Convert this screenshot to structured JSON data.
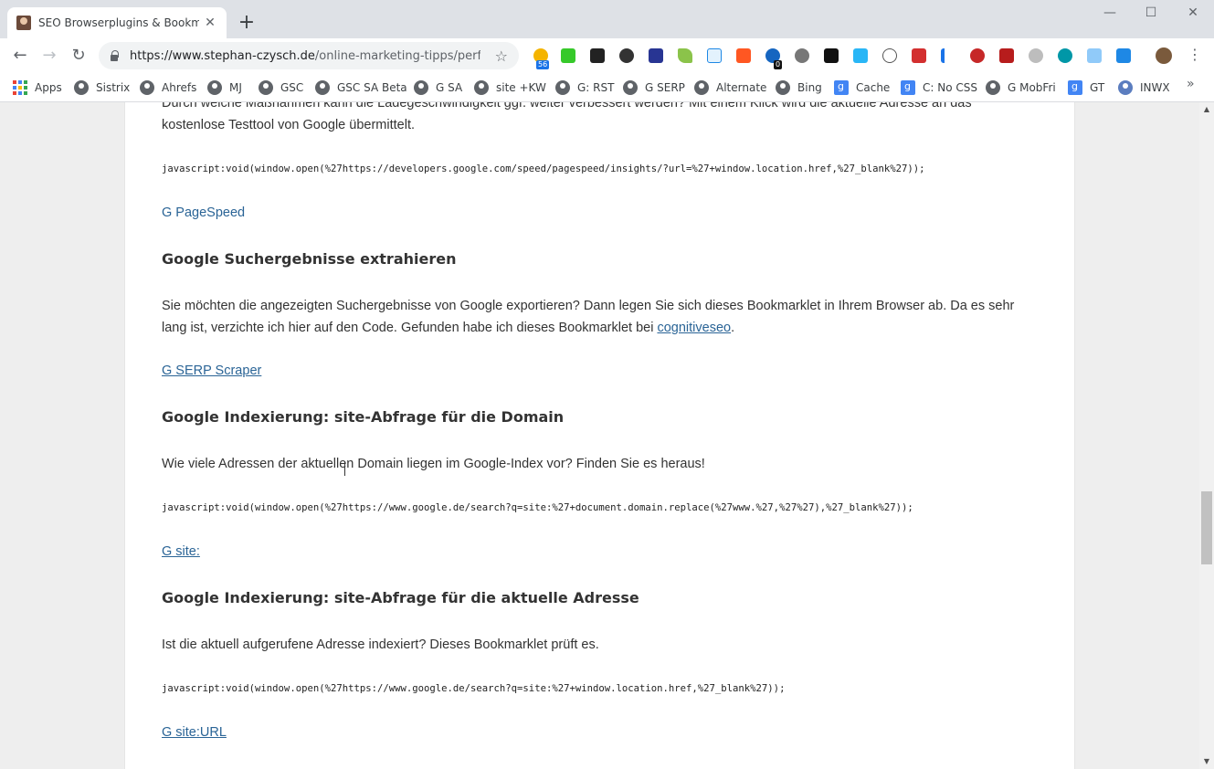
{
  "browser": {
    "tab_title": "SEO Browserplugins & Bookmarklets",
    "tab_close": "✕",
    "new_tab": "+",
    "window": {
      "minimize": "—",
      "maximize": "☐",
      "close": "✕"
    },
    "nav": {
      "back": "←",
      "forward": "→",
      "reload": "↻"
    },
    "url_host": "https://www.stephan-czysch.de",
    "url_path": "/online-marketing-tipps/perf...",
    "star": "☆",
    "ext_badges": {
      "first": "56",
      "second": "0"
    },
    "menu": "⋮",
    "bookmarks": [
      {
        "label": "Apps",
        "icon": "apps-grid-icon"
      },
      {
        "label": "Sistrix",
        "icon": "globe-icon"
      },
      {
        "label": "Ahrefs",
        "icon": "globe-icon"
      },
      {
        "label": "MJ",
        "icon": "globe-icon"
      },
      {
        "label": "GSC",
        "icon": "globe-icon"
      },
      {
        "label": "GSC SA Beta",
        "icon": "globe-icon"
      },
      {
        "label": "G SA",
        "icon": "globe-icon"
      },
      {
        "label": "site +KW",
        "icon": "globe-icon"
      },
      {
        "label": "G: RST",
        "icon": "globe-icon"
      },
      {
        "label": "G SERP",
        "icon": "globe-icon"
      },
      {
        "label": "Alternate",
        "icon": "globe-icon"
      },
      {
        "label": "Bing",
        "icon": "globe-icon"
      },
      {
        "label": "Cache",
        "icon": "google-icon"
      },
      {
        "label": "C: No CSS",
        "icon": "google-icon"
      },
      {
        "label": "G MobFri",
        "icon": "globe-icon"
      },
      {
        "label": "GT",
        "icon": "google-icon"
      },
      {
        "label": "INWX",
        "icon": "world-icon"
      }
    ],
    "bookmarks_more": "»"
  },
  "article": {
    "intro_line1": "Durch welche Maßnahmen kann die Ladegeschwindigkeit ggf. weiter verbessert werden? Mit einem Klick wird die aktuelle Adresse an das",
    "intro_line2": "kostenlose Testtool von Google übermittelt.",
    "code_pagespeed": "javascript:void(window.open(%27https://developers.google.com/speed/pagespeed/insights/?url=%27+window.location.href,%27_blank%27));",
    "link_pagespeed": "G PageSpeed",
    "h_serp": "Google Suchergebnisse extrahieren",
    "p_serp_1": "Sie möchten die angezeigten Suchergebnisse von Google exportieren? Dann legen Sie sich dieses Bookmarklet in Ihrem Browser ab. Da es sehr",
    "p_serp_2_a": "lang ist, verzichte ich hier auf den Code. Gefunden habe ich dieses Bookmarklet bei ",
    "p_serp_2_link": "cognitiveseo",
    "p_serp_2_b": ".",
    "link_serp": "G SERP Scraper",
    "h_site": "Google Indexierung: site-Abfrage für die Domain",
    "p_site": "Wie viele Adressen der aktuellen Domain liegen im Google-Index vor? Finden Sie es heraus!",
    "code_site": "javascript:void(window.open(%27https://www.google.de/search?q=site:%27+document.domain.replace(%27www.%27,%27%27),%27_blank%27));",
    "link_site": "G site:",
    "h_siteurl": "Google Indexierung: site-Abfrage für die aktuelle Adresse",
    "p_siteurl": "Ist die aktuell aufgerufene Adresse indexiert? Dieses Bookmarklet prüft es.",
    "code_siteurl": "javascript:void(window.open(%27https://www.google.de/search?q=site:%27+window.location.href,%27_blank%27));",
    "link_siteurl": "G site:URL"
  },
  "scrollbar": {
    "up": "▲",
    "down": "▼",
    "position": 0.62
  }
}
